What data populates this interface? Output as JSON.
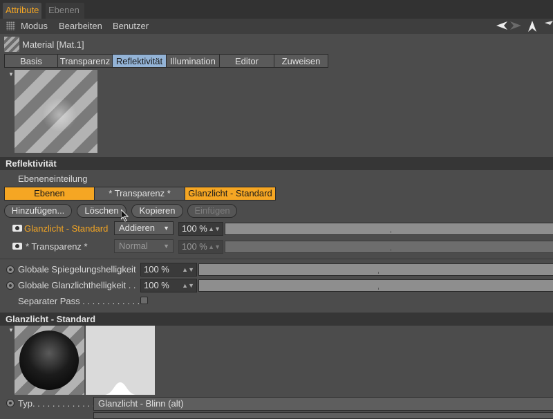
{
  "top_tabs": {
    "attribute": "Attribute",
    "ebenen": "Ebenen"
  },
  "menubar": {
    "items": [
      "Modus",
      "Bearbeiten",
      "Benutzer"
    ]
  },
  "material": {
    "name": "Material [Mat.1]"
  },
  "tabs": [
    {
      "label": "Basis",
      "active": false
    },
    {
      "label": "Transparenz",
      "active": false
    },
    {
      "label": "Reflektivität",
      "active": true
    },
    {
      "label": "Illumination",
      "active": false
    },
    {
      "label": "Editor",
      "active": false
    },
    {
      "label": "Zuweisen",
      "active": false
    }
  ],
  "reflectivity": {
    "title": "Reflektivität",
    "layer_division_label": "Ebeneneinteilung",
    "layer_buttons": [
      "Ebenen",
      "* Transparenz *",
      "Glanzlicht - Standard"
    ],
    "actions": {
      "add": "Hinzufügen...",
      "delete": "Löschen",
      "copy": "Kopieren",
      "paste": "Einfügen"
    },
    "layers": [
      {
        "name": "Glanzlicht - Standard",
        "mode": "Addieren",
        "amount": "100 %",
        "amount_value": 100,
        "active": true
      },
      {
        "name": "* Transparenz *",
        "mode": "Normal",
        "amount": "100 %",
        "amount_value": 100,
        "active": false
      }
    ],
    "global_mirror": {
      "label": "Globale Spiegelungshelligkeit",
      "value": "100 %"
    },
    "global_gloss": {
      "label": "Globale Glanzlichthelligkeit . .",
      "value": "100 %"
    },
    "separate_pass": {
      "label": "Separater Pass . . . . . . . . . . . .",
      "checked": false
    }
  },
  "gloss_section": {
    "title": "Glanzlicht - Standard",
    "type_label": "Typ. . . . . . . . . . . . . . . . . .",
    "type_value": "Glanzlicht - Blinn (alt)"
  },
  "colors": {
    "accent": "#f5a623",
    "active_tab": "#93b3d6",
    "background": "#4c4c4c"
  }
}
